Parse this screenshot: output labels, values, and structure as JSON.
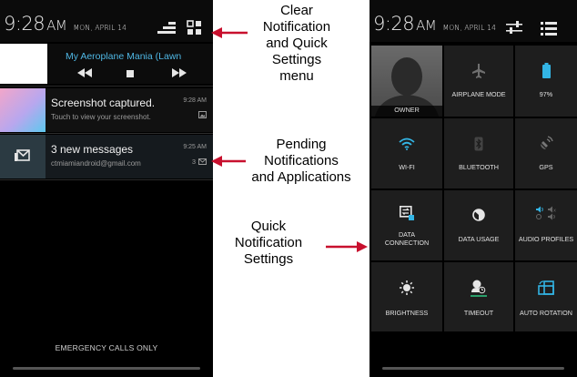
{
  "status_bar": {
    "time": "9:28",
    "ampm": "AM",
    "date": "MON, APRIL 14"
  },
  "notifications": {
    "music": {
      "title": "My Aeroplane Mania (Lawn"
    },
    "screenshot": {
      "title": "Screenshot captured.",
      "subtitle": "Touch to view your screenshot.",
      "time": "9:28 AM"
    },
    "messages": {
      "title": "3 new messages",
      "subtitle": "ctmiamiandroid@gmail.com",
      "time": "9:25 AM",
      "count": "3"
    }
  },
  "lockscreen": {
    "emergency_label": "EMERGENCY CALLS ONLY"
  },
  "quick_settings": {
    "accent_color": "#33b5e5",
    "tiles": [
      {
        "label": "OWNER",
        "icon": "owner-avatar-icon"
      },
      {
        "label": "AIRPLANE MODE",
        "icon": "airplane-icon"
      },
      {
        "label": "97%",
        "icon": "battery-icon"
      },
      {
        "label": "WI-FI",
        "icon": "wifi-icon"
      },
      {
        "label": "BLUETOOTH",
        "icon": "bluetooth-icon"
      },
      {
        "label": "GPS",
        "icon": "gps-icon"
      },
      {
        "label": "DATA\nCONNECTION",
        "icon": "data-connection-icon"
      },
      {
        "label": "DATA USAGE",
        "icon": "data-usage-icon"
      },
      {
        "label": "AUDIO PROFILES",
        "icon": "audio-profiles-icon"
      },
      {
        "label": "BRIGHTNESS",
        "icon": "brightness-icon"
      },
      {
        "label": "TIMEOUT",
        "icon": "timeout-icon"
      },
      {
        "label": "AUTO ROTATION",
        "icon": "auto-rotation-icon"
      }
    ]
  },
  "annotations": {
    "clear": "Clear\nNotification\nand Quick\nSettings\nmenu",
    "pending": "Pending\nNotifications\nand Applications",
    "quick": "Quick\nNotification\nSettings",
    "arrow_color": "#c8102e"
  }
}
